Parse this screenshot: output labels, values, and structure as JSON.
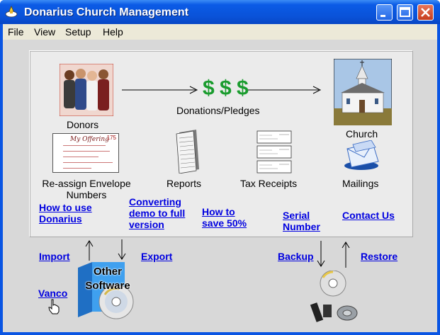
{
  "window": {
    "title": "Donarius Church Management"
  },
  "menu": [
    {
      "label": "File"
    },
    {
      "label": "View"
    },
    {
      "label": "Setup"
    },
    {
      "label": "Help"
    }
  ],
  "panel": {
    "donors": "Donors",
    "donations": "Donations/Pledges",
    "dollar": "$",
    "church": "Church",
    "envelope_line1": "Re-assign Envelope",
    "envelope_line2": "Numbers",
    "reports": "Reports",
    "tax_receipts": "Tax Receipts",
    "mailings": "Mailings",
    "offering_card_text": "My Offering",
    "offering_card_number": "175",
    "links": {
      "how_to_use_1": "How to use",
      "how_to_use_2": "Donarius",
      "converting_1": "Converting",
      "converting_2": "demo to full",
      "converting_3": "version",
      "save_1": "How to",
      "save_2": "save 50%",
      "serial_1": "Serial",
      "serial_2": "Number",
      "contact": "Contact Us"
    }
  },
  "bottom": {
    "import": "Import",
    "export": "Export",
    "vanco": "Vanco",
    "other_software_1": "Other",
    "other_software_2": "Software",
    "backup": "Backup",
    "restore": "Restore"
  }
}
